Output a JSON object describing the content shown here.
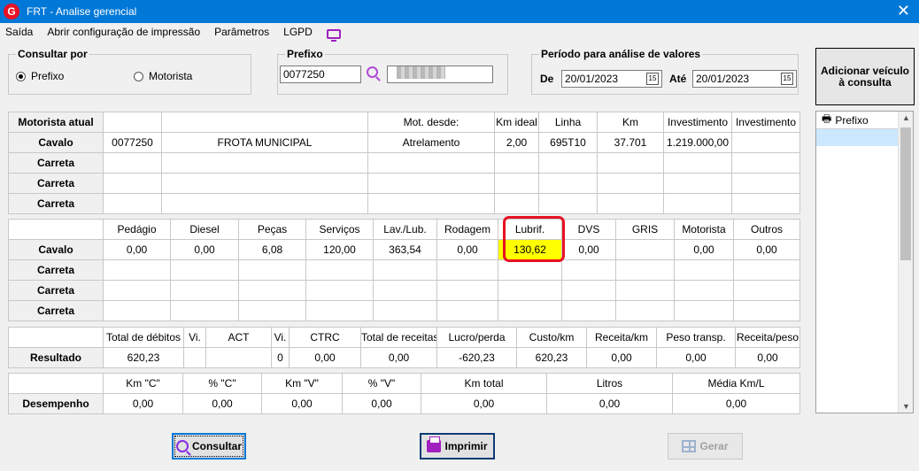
{
  "window": {
    "title": "FRT - Analise gerencial",
    "app_icon": "G"
  },
  "menu": [
    "Saída",
    "Abrir configuração de impressão",
    "Parâmetros",
    "LGPD"
  ],
  "consultar_por": {
    "label": "Consultar por",
    "options": [
      "Prefixo",
      "Motorista"
    ],
    "selected": "Prefixo"
  },
  "prefixo": {
    "label": "Prefixo",
    "value": "0077250"
  },
  "periodo": {
    "label": "Período para análise de valores",
    "de_label": "De",
    "de_value": "20/01/2023",
    "ate_label": "Até",
    "ate_value": "20/01/2023",
    "calendar_glyph": "15"
  },
  "side": {
    "add_button": "Adicionar veículo à consulta",
    "list_header": "Prefixo"
  },
  "vehicle_table": {
    "headers": [
      "Motorista atual",
      "",
      "",
      "Mot. desde:",
      "Km ideal",
      "Linha",
      "Km",
      "Investimento",
      "Investimento"
    ],
    "rows": [
      [
        "Cavalo",
        "0077250",
        "FROTA MUNICIPAL",
        "Atrelamento",
        "2,00",
        "695T10",
        "37.701",
        "1.219.000,00",
        ""
      ],
      [
        "Carreta",
        "",
        "",
        "",
        "",
        "",
        "",
        "",
        ""
      ],
      [
        "Carreta",
        "",
        "",
        "",
        "",
        "",
        "",
        "",
        ""
      ],
      [
        "Carreta",
        "",
        "",
        "",
        "",
        "",
        "",
        "",
        ""
      ]
    ]
  },
  "cost_table": {
    "headers": [
      "",
      "Pedágio",
      "Diesel",
      "Peças",
      "Serviços",
      "Lav./Lub.",
      "Rodagem",
      "Lubrif.",
      "DVS",
      "GRIS",
      "Motorista",
      "Outros"
    ],
    "rows": [
      [
        "Cavalo",
        "0,00",
        "0,00",
        "6,08",
        "120,00",
        "363,54",
        "0,00",
        "130,62",
        "0,00",
        "",
        "0,00",
        "0,00"
      ],
      [
        "Carreta",
        "",
        "",
        "",
        "",
        "",
        "",
        "",
        "",
        "",
        "",
        ""
      ],
      [
        "Carreta",
        "",
        "",
        "",
        "",
        "",
        "",
        "",
        "",
        "",
        "",
        ""
      ],
      [
        "Carreta",
        "",
        "",
        "",
        "",
        "",
        "",
        "",
        "",
        "",
        "",
        ""
      ]
    ],
    "highlight_color": "#ffff00"
  },
  "result_table": {
    "headers": [
      "",
      "Total de débitos",
      "Vi.",
      "ACT",
      "Vi.",
      "CTRC",
      "Total de receitas",
      "Lucro/perda",
      "Custo/km",
      "Receita/km",
      "Peso transp.",
      "Receita/peso"
    ],
    "rows": [
      [
        "Resultado",
        "620,23",
        "",
        "",
        "0",
        "0,00",
        "0,00",
        "-620,23",
        "620,23",
        "0,00",
        "0,00",
        "0,00"
      ]
    ]
  },
  "perf_table": {
    "headers": [
      "",
      "Km \"C\"",
      "% \"C\"",
      "Km \"V\"",
      "% \"V\"",
      "Km total",
      "Litros",
      "Média Km/L"
    ],
    "rows": [
      [
        "Desempenho",
        "0,00",
        "0,00",
        "0,00",
        "0,00",
        "0,00",
        "0,00",
        "0,00"
      ]
    ]
  },
  "buttons": {
    "consultar": "Consultar",
    "imprimir": "Imprimir",
    "gerar": "Gerar"
  },
  "colors": {
    "titlebar": "#0078d7",
    "accent_icon": "#a020c0",
    "highlight_box": "#e81123"
  }
}
